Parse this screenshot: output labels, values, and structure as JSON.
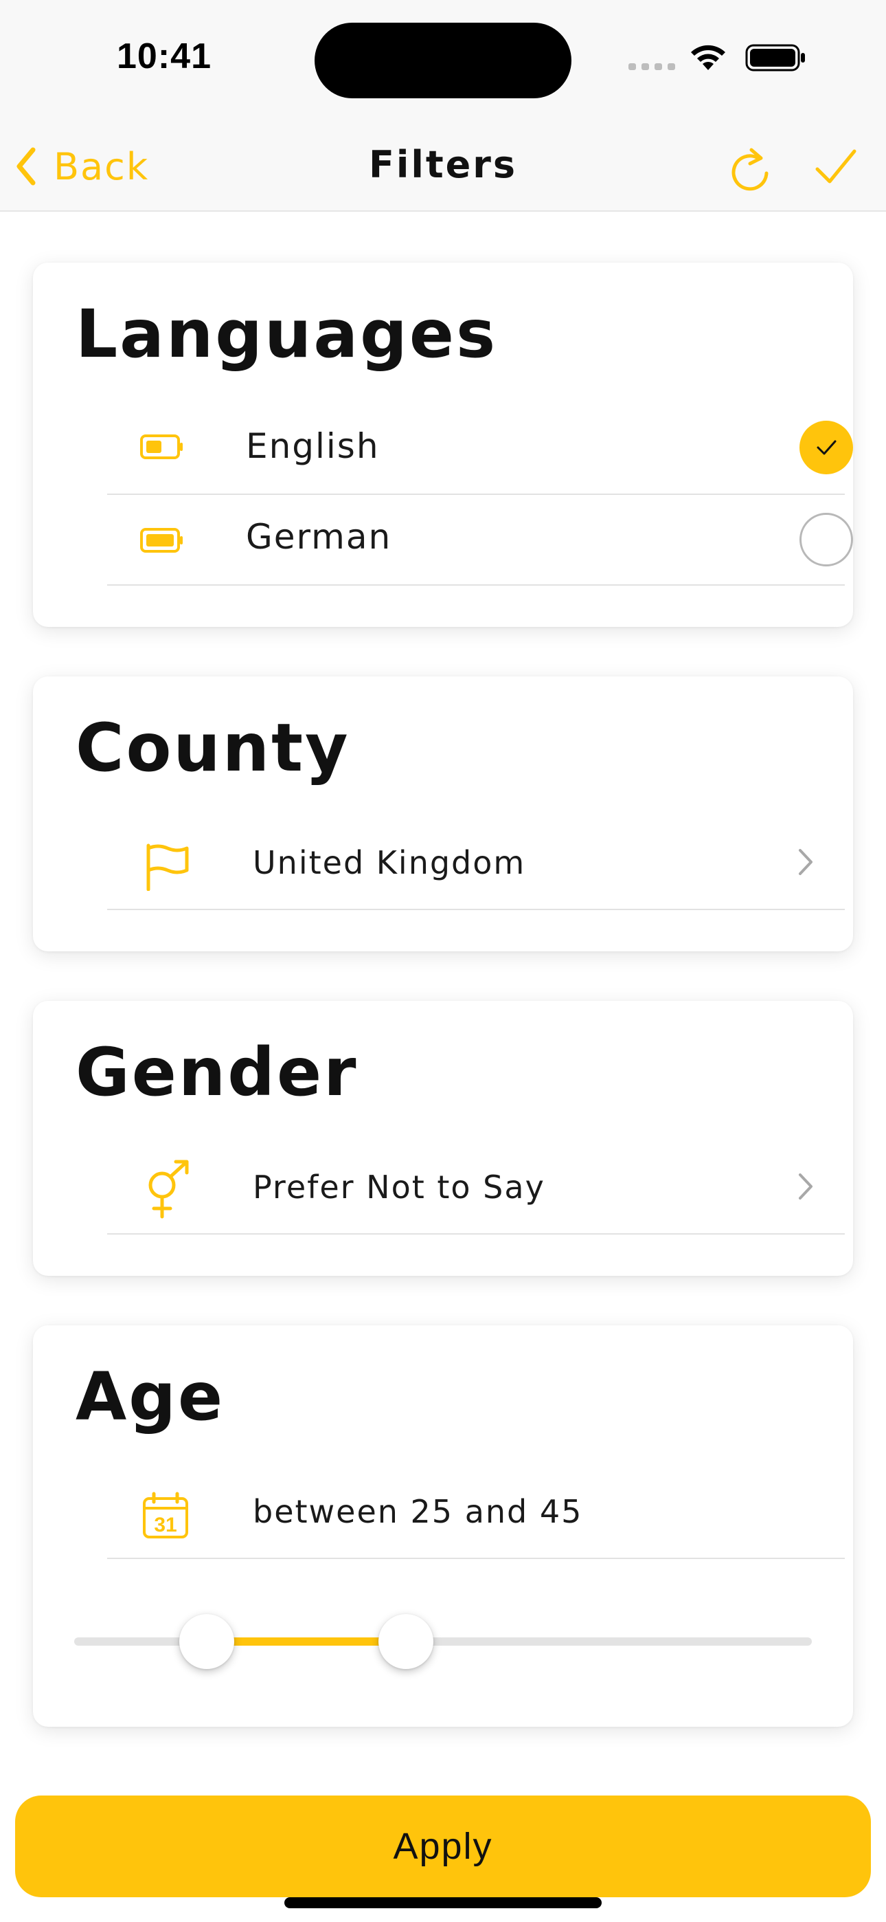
{
  "status_bar": {
    "time": "10:41"
  },
  "nav": {
    "back_label": "Back",
    "title": "Filters",
    "reset_icon": "refresh-icon",
    "done_icon": "checkmark-icon"
  },
  "accent_color": "#FFC40C",
  "languages": {
    "title": "Languages",
    "items": [
      {
        "label": "English",
        "icon": "battery-half-icon",
        "selected": true
      },
      {
        "label": "German",
        "icon": "battery-full-icon",
        "selected": false
      }
    ]
  },
  "county": {
    "title": "County",
    "value": "United Kingdom",
    "icon": "flag-icon"
  },
  "gender": {
    "title": "Gender",
    "value": "Prefer Not to Say",
    "icon": "gender-icon"
  },
  "age": {
    "title": "Age",
    "summary": "between 25 and 45",
    "icon": "calendar-icon",
    "calendar_day": "31",
    "range_fraction": {
      "low": 0.18,
      "high": 0.45
    }
  },
  "apply_label": "Apply"
}
